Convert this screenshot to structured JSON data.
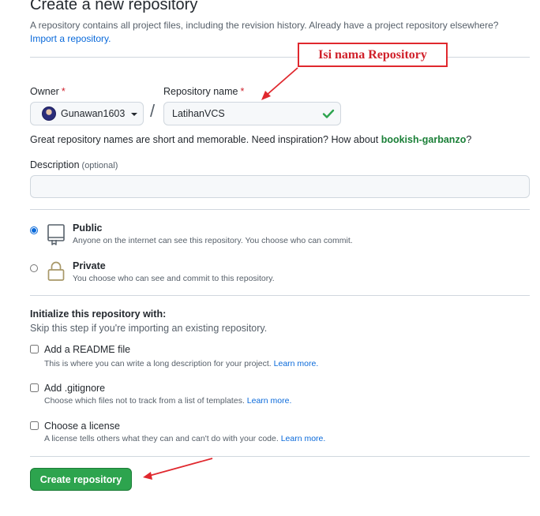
{
  "header": {
    "title": "Create a new repository",
    "subtitle": "A repository contains all project files, including the revision history. Already have a project repository elsewhere?",
    "import_link": "Import a repository."
  },
  "owner": {
    "label": "Owner",
    "required_mark": "*",
    "value": "Gunawan1603"
  },
  "separator": "/",
  "repo_name": {
    "label": "Repository name",
    "required_mark": "*",
    "value": "LatihanVCS"
  },
  "hint": {
    "text": "Great repository names are short and memorable. Need inspiration? How about",
    "suggestion": "bookish-garbanzo",
    "end": "?"
  },
  "description": {
    "label": "Description",
    "optional": "(optional)",
    "value": ""
  },
  "visibility": {
    "selected": "public",
    "public": {
      "title": "Public",
      "desc": "Anyone on the internet can see this repository. You choose who can commit.",
      "icon": "repo-icon"
    },
    "private": {
      "title": "Private",
      "desc": "You choose who can see and commit to this repository.",
      "icon": "lock-icon"
    }
  },
  "init": {
    "title": "Initialize this repository with:",
    "subtitle": "Skip this step if you're importing an existing repository.",
    "readme": {
      "title": "Add a README file",
      "desc": "This is where you can write a long description for your project.",
      "link": "Learn more.",
      "checked": false
    },
    "gitignore": {
      "title": "Add .gitignore",
      "desc": "Choose which files not to track from a list of templates.",
      "link": "Learn more.",
      "checked": false
    },
    "license": {
      "title": "Choose a license",
      "desc": "A license tells others what they can and can't do with your code.",
      "link": "Learn more.",
      "checked": false
    }
  },
  "submit_label": "Create repository",
  "annotation": {
    "text": "Isi nama Repository"
  },
  "colors": {
    "accent": "#0969da",
    "primary_button": "#2da44e",
    "annotation": "#e0282e",
    "suggestion": "#1a7f37"
  }
}
